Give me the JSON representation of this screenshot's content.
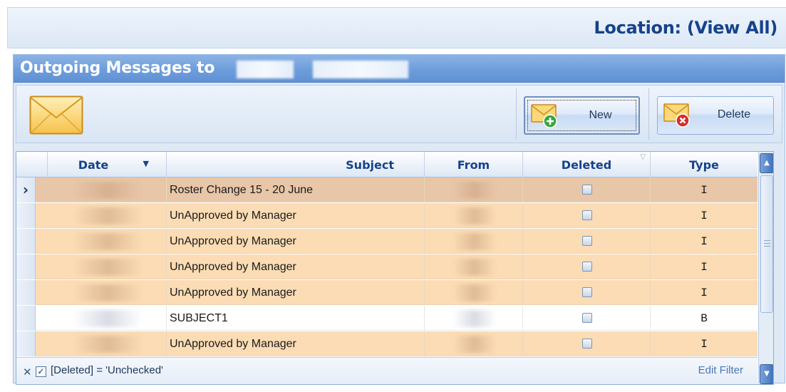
{
  "location": {
    "label": "Location: (View All)"
  },
  "panel": {
    "title": "Outgoing Messages to"
  },
  "toolbar": {
    "new_label": "New",
    "delete_label": "Delete",
    "icons": {
      "main": "envelope-icon",
      "new": "envelope-add-icon",
      "delete": "envelope-delete-icon"
    }
  },
  "grid": {
    "columns": {
      "date": "Date",
      "subject": "Subject",
      "from": "From",
      "deleted": "Deleted",
      "type": "Type"
    },
    "rows": [
      {
        "subject": "Roster Change 15 - 20 June",
        "type": "I",
        "deleted": false,
        "selected": true
      },
      {
        "subject": "UnApproved by Manager",
        "type": "I",
        "deleted": false,
        "selected": false
      },
      {
        "subject": "UnApproved by Manager",
        "type": "I",
        "deleted": false,
        "selected": false
      },
      {
        "subject": "UnApproved by Manager",
        "type": "I",
        "deleted": false,
        "selected": false
      },
      {
        "subject": "UnApproved by Manager",
        "type": "I",
        "deleted": false,
        "selected": false
      },
      {
        "subject": "SUBJECT1",
        "type": "B",
        "deleted": false,
        "selected": false
      },
      {
        "subject": "UnApproved by Manager",
        "type": "I",
        "deleted": false,
        "selected": false
      }
    ],
    "filter": {
      "text": "[Deleted] = 'Unchecked'",
      "checked": true,
      "edit_label": "Edit Filter"
    }
  },
  "colors": {
    "accent": "#15428b",
    "row_orange": "#fbdcb4",
    "row_selected": "#e8c6a8",
    "header_blue": "#6e9ddb"
  }
}
